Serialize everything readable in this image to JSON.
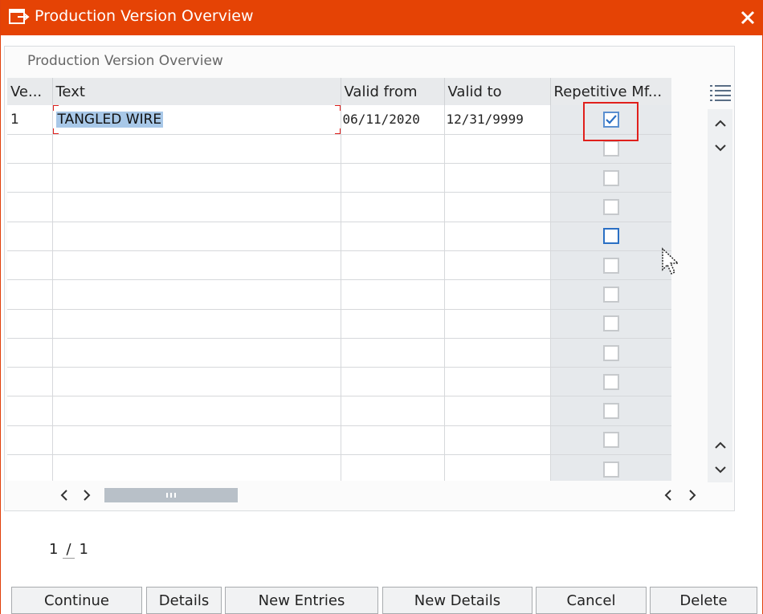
{
  "window": {
    "title": "Production Version Overview",
    "accent_color": "#e54305"
  },
  "panel": {
    "title": "Production Version Overview"
  },
  "table": {
    "columns": [
      "Ve...",
      "Text",
      "Valid from",
      "Valid to",
      "Repetitive Mf..."
    ],
    "rows": [
      {
        "version": "1",
        "text": "TANGLED WIRE",
        "valid_from": "06/11/2020",
        "valid_to": "12/31/9999",
        "repetitive": true
      }
    ],
    "empty_row_count": 12
  },
  "pager": {
    "current": "1",
    "separator": "/",
    "total": "1"
  },
  "buttons": {
    "continue": "Continue",
    "details": "Details",
    "new_entries": "New Entries",
    "new_details": "New Details",
    "cancel": "Cancel",
    "delete": "Delete"
  },
  "icons": {
    "app": "display-window-icon",
    "close": "close-icon",
    "column_menu": "column-settings-icon",
    "scroll_up": "chevron-up-icon",
    "scroll_down": "chevron-down-icon",
    "scroll_left": "chevron-left-icon",
    "scroll_right": "chevron-right-icon"
  }
}
